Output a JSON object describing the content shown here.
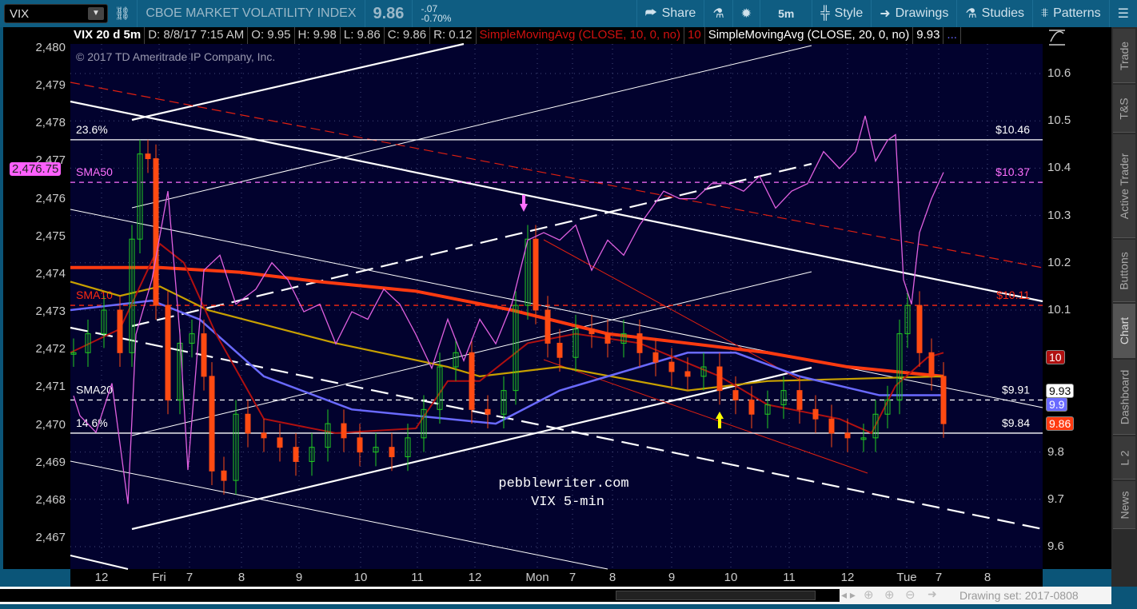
{
  "toolbar": {
    "symbol": "VIX",
    "description": "CBOE MARKET VOLATILITY INDEX",
    "last": "9.86",
    "change": "-.07",
    "change_pct": "-0.70%",
    "share": "Share",
    "timeframe": "5m",
    "style": "Style",
    "drawings": "Drawings",
    "studies": "Studies",
    "patterns": "Patterns"
  },
  "infobar": {
    "title": "VIX 20 d 5m",
    "date": "D: 8/8/17 7:15 AM",
    "open": "O: 9.95",
    "high": "H: 9.98",
    "low": "L: 9.86",
    "close": "C: 9.86",
    "range": "R: 0.12",
    "sma10_label": "SimpleMovingAvg (CLOSE, 10, 0, no)",
    "sma10_value": "10",
    "sma20_label": "SimpleMovingAvg (CLOSE, 20, 0, no)",
    "sma20_value": "9.93",
    "more": "..."
  },
  "sidebar": {
    "tabs": [
      "Trade",
      "T&S",
      "Active Trader",
      "Buttons",
      "Chart",
      "Dashboard",
      "L 2",
      "News"
    ],
    "selected": "Chart"
  },
  "bottombar": {
    "drawing_set": "Drawing set: 2017-0808"
  },
  "colors": {
    "up": "#22cc22",
    "down": "#ff4a12",
    "spx": "#e060e0",
    "sma_thick": "#ff3a10",
    "sma_gold": "#c8a000",
    "sma_blue": "#6a6aff",
    "sma_darkred": "#b01010",
    "sma_white": "#ffffff",
    "bg": "#02022e"
  },
  "chart_data": {
    "type": "line",
    "copyright": "© 2017 TD Ameritrade IP Company, Inc.",
    "watermark": [
      "pebblewriter.com",
      "VIX 5-min"
    ],
    "x_unit": "5-min bar position",
    "xlim": [
      0,
      121.6
    ],
    "x_ticks": [
      {
        "label": "12",
        "x": 3.9
      },
      {
        "label": "Fri",
        "x": 11.1
      },
      {
        "label": "7",
        "x": 14.9
      },
      {
        "label": "8",
        "x": 21.4
      },
      {
        "label": "9",
        "x": 28.6
      },
      {
        "label": "10",
        "x": 36.3
      },
      {
        "label": "11",
        "x": 43.4
      },
      {
        "label": "12",
        "x": 50.6
      },
      {
        "label": "Mon",
        "x": 58.4
      },
      {
        "label": "7",
        "x": 62.8
      },
      {
        "label": "8",
        "x": 67.8
      },
      {
        "label": "9",
        "x": 75.2
      },
      {
        "label": "10",
        "x": 82.6
      },
      {
        "label": "11",
        "x": 89.9
      },
      {
        "label": "12",
        "x": 97.2
      },
      {
        "label": "Tue",
        "x": 104.6
      },
      {
        "label": "7",
        "x": 108.6
      },
      {
        "label": "8",
        "x": 114.7
      }
    ],
    "right_axis": {
      "label": "VIX",
      "ylim": [
        9.55,
        10.66
      ],
      "ticks": [
        "10.6",
        "10.5",
        "10.4",
        "10.3",
        "10.2",
        "10.1",
        "9.8",
        "9.7",
        "9.6"
      ]
    },
    "left_axis": {
      "label": "SPX",
      "ylim": [
        2466.5,
        2480
      ],
      "ticks": [
        "2,480",
        "2,479",
        "2,478",
        "2,477",
        "2,476",
        "2,475",
        "2,474",
        "2,473",
        "2,472",
        "2,471",
        "2,470",
        "2,469",
        "2,468",
        "2,467"
      ],
      "badge": "2,476.75"
    },
    "vix_close": {
      "x": [
        0.4,
        2.2,
        4.2,
        6.2,
        7.7,
        8.7,
        9.7,
        10.7,
        12.2,
        13.7,
        15.2,
        16.7,
        17.7,
        19.2,
        20.7,
        22.2,
        24.2,
        26.2,
        28.2,
        30.2,
        32.2,
        34.2,
        36.2,
        38.2,
        40.2,
        42.2,
        44.2,
        46.2,
        48.2,
        50.2,
        52.2,
        54.2,
        55.7,
        57.2,
        58.2,
        59.7,
        61.2,
        63.2,
        65.2,
        67.2,
        69.2,
        71.2,
        73.2,
        75.2,
        77.2,
        79.2,
        81.2,
        83.2,
        85.2,
        87.2,
        89.2,
        91.2,
        93.2,
        95.2,
        97.2,
        99.2,
        100.7,
        102.2,
        103.7,
        104.7,
        106.2,
        107.7,
        109.2
      ],
      "y": [
        10.01,
        10.05,
        10.1,
        10.01,
        10.25,
        10.43,
        10.42,
        10.11,
        9.91,
        10.03,
        10.05,
        9.96,
        9.76,
        9.74,
        9.88,
        9.84,
        9.83,
        9.81,
        9.78,
        9.81,
        9.86,
        9.83,
        9.8,
        9.81,
        9.79,
        9.83,
        9.89,
        9.98,
        10.01,
        9.89,
        9.88,
        9.93,
        10.11,
        10.25,
        10.1,
        10.03,
        10.0,
        10.06,
        10.05,
        10.03,
        10.05,
        10.01,
        9.99,
        9.97,
        9.96,
        9.98,
        9.93,
        9.91,
        9.88,
        9.9,
        9.93,
        9.89,
        9.87,
        9.84,
        9.83,
        9.83,
        9.88,
        9.91,
        10.05,
        10.11,
        10.01,
        9.96,
        9.86
      ]
    },
    "spx": {
      "x": [
        0.4,
        1.2,
        3.2,
        5.2,
        7.2,
        8.2,
        10.2,
        12.2,
        13.7,
        14.7,
        16.7,
        18.7,
        20.7,
        23.2,
        25.2,
        27.2,
        29.2,
        31.2,
        33.2,
        35.2,
        37.2,
        39.2,
        41.2,
        43.2,
        45.2,
        47.2,
        49.2,
        51.2,
        53.2,
        55.2,
        57.2,
        59.2,
        61.2,
        63.2,
        65.2,
        67.2,
        69.2,
        71.2,
        72.7,
        74.2,
        76.2,
        78.2,
        80.2,
        82.2,
        84.2,
        86.2,
        88.2,
        90.2,
        92.2,
        94.2,
        96.2,
        98.2,
        99.4,
        100.7,
        102.2,
        103.2,
        104.2,
        105.2,
        106.2,
        107.7,
        109.2
      ],
      "y": [
        2470.77,
        2470.24,
        2469.8,
        2471.1,
        2467.9,
        2472.4,
        2473.85,
        2476.2,
        2472.4,
        2468.8,
        2474.1,
        2474.5,
        2473.2,
        2473.6,
        2474.3,
        2473.85,
        2473.0,
        2473.2,
        2472.15,
        2473.0,
        2472.8,
        2473.6,
        2473.2,
        2472.4,
        2471.5,
        2472.8,
        2471.7,
        2472.8,
        2472.15,
        2473.2,
        2474.9,
        2475.1,
        2474.9,
        2475.3,
        2474.1,
        2474.9,
        2474.5,
        2475.3,
        2475.75,
        2476.2,
        2476.0,
        2476.0,
        2476.4,
        2476.4,
        2476.2,
        2476.6,
        2475.75,
        2476.2,
        2476.4,
        2477.25,
        2476.8,
        2477.25,
        2478.2,
        2477.0,
        2477.55,
        2477.7,
        2473.85,
        2473.2,
        2475.1,
        2476.0,
        2476.7
      ]
    },
    "moving_averages": [
      {
        "name": "thick",
        "color_key": "sma_thick",
        "x": [
          0,
          11.2,
          21.2,
          31.2,
          43.2,
          55.2,
          67.2,
          77.2,
          87.2,
          97.2,
          109.2
        ],
        "y": [
          10.19,
          10.19,
          10.18,
          10.16,
          10.14,
          10.1,
          10.05,
          10.03,
          10.01,
          9.98,
          9.96
        ]
      },
      {
        "name": "gold",
        "color_key": "sma_gold",
        "x": [
          0,
          6.2,
          11.2,
          17.2,
          33.2,
          47.2,
          51.2,
          61.2,
          77.2,
          87.2,
          109.2
        ],
        "y": [
          10.16,
          10.13,
          10.15,
          10.1,
          10.03,
          9.98,
          9.96,
          9.98,
          9.93,
          9.95,
          9.96
        ]
      },
      {
        "name": "SMA20",
        "color_key": "sma_blue",
        "x": [
          0,
          10.2,
          16.2,
          24.2,
          35.2,
          47.2,
          53.2,
          61.2,
          67.2,
          77.2,
          83.2,
          91.2,
          101.2,
          109.2
        ],
        "y": [
          10.1,
          10.12,
          10.08,
          9.96,
          9.89,
          9.87,
          9.86,
          9.93,
          9.96,
          10.01,
          10.01,
          9.96,
          9.92,
          9.92
        ]
      },
      {
        "name": "SMA10",
        "color_key": "sma_darkred",
        "x": [
          0,
          6.2,
          11.2,
          14.2,
          18.2,
          24.2,
          33.2,
          43.2,
          47.2,
          51.2,
          57.2,
          63.2,
          71.2,
          81.2,
          87.2,
          96.2,
          100.2,
          103.2,
          107.2,
          109.2
        ],
        "y": [
          10.01,
          10.06,
          10.24,
          10.2,
          10.05,
          9.87,
          9.84,
          9.85,
          9.95,
          9.95,
          10.03,
          10.05,
          10.03,
          9.96,
          9.9,
          9.87,
          9.84,
          9.94,
          10.0,
          10.01
        ]
      }
    ],
    "levels": [
      {
        "left_label": "23.6%",
        "right_label": "$10.46",
        "value": 10.46,
        "color": "#ffffff",
        "dashed": false
      },
      {
        "left_label": "SMA50",
        "right_label": "$10.37",
        "value": 10.37,
        "color": "#ff70ff",
        "dashed": true
      },
      {
        "left_label": "SMA10",
        "right_label": "$10.11",
        "value": 10.11,
        "color": "#ff2a10",
        "dashed": true
      },
      {
        "left_label": "SMA20",
        "right_label": "$9.91",
        "value": 9.91,
        "color": "#ffffff",
        "dashed": true
      },
      {
        "left_label": "14.6%",
        "right_label": "$9.84",
        "value": 9.84,
        "color": "#ffffff",
        "dashed": false
      }
    ],
    "price_badges": [
      {
        "text": "10",
        "value": 10.0,
        "bg": "#b01010",
        "fg": "#fff"
      },
      {
        "text": "9.93",
        "value": 9.93,
        "bg": "#ffffff",
        "fg": "#000"
      },
      {
        "text": "9.9",
        "value": 9.9,
        "bg": "#6a6aff",
        "fg": "#fff"
      },
      {
        "text": "9.86",
        "value": 9.86,
        "bg": "#ff3a10",
        "fg": "#fff"
      }
    ]
  }
}
